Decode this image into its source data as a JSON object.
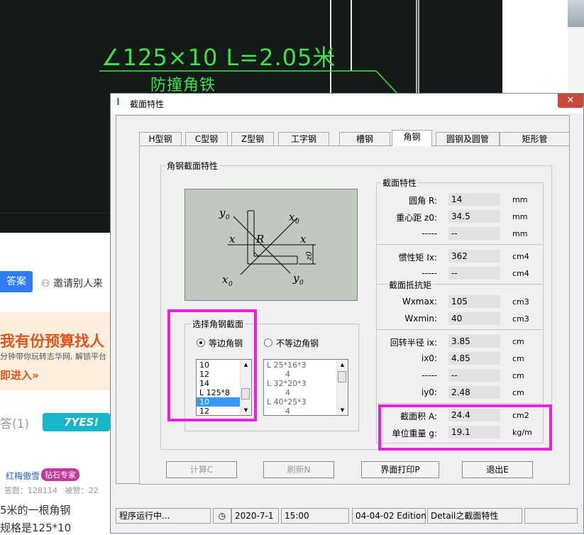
{
  "background": {
    "cad_annotation": "∠125×10   L=2.05米",
    "cad_note": "防撞角铁",
    "answer_button": "答案",
    "invite_link": "邀请别人来",
    "banner": {
      "main_prefix": "我有份预算",
      "main_highlight": "找人",
      "sub": "分钟带你玩转志华网, 解锁平台",
      "go": "即进入»"
    },
    "answers_count": "答(1)",
    "yes_logo": "7YES!",
    "user": {
      "name": "红梅傲雪",
      "tag": "钻石专家",
      "stats_answers_label": "答题：",
      "stats_answers": "128114",
      "stats_liked_label": "被赞：",
      "stats_liked": "22"
    },
    "post_line1": "5米的一根角钢",
    "post_line2": "规格是125*10"
  },
  "dialog": {
    "title": "截面特性",
    "close": "✕",
    "tabs": [
      {
        "label": "H型钢"
      },
      {
        "label": "C型钢"
      },
      {
        "label": "Z型钢"
      },
      {
        "label": "工字钢"
      },
      {
        "label": "槽钢"
      },
      {
        "label": "角钢",
        "active": true
      },
      {
        "label": "圆钢及圆管"
      },
      {
        "label": "矩形管"
      }
    ],
    "angle_group_label": "角钢截面特性",
    "diagram_labels": {
      "y0_top": "y",
      "x0_top": "x",
      "x_left": "x",
      "R": "R",
      "x_right": "x",
      "z0": "z0",
      "x0_bottom": "x",
      "y0_bottom": "y",
      "sub0": "0"
    },
    "select_group_label": "选择角钢截面",
    "radio_equal": "等边角钢",
    "radio_unequal": "不等边角钢",
    "equal_list": [
      "10",
      "12",
      "14",
      "L 125*8",
      "10",
      "12"
    ],
    "equal_selected_index": 4,
    "unequal_list": [
      "L 25*16*3",
      "4",
      "L 32*20*3",
      "4",
      "L 40*25*3",
      "4"
    ],
    "props_group_label": "截面特性",
    "rows": [
      {
        "label": "圆角  R:",
        "value": "14",
        "unit": "mm"
      },
      {
        "label": "重心距 z0:",
        "value": "34.5",
        "unit": "mm"
      },
      {
        "label": "-----",
        "value": "--",
        "unit": "mm"
      },
      {
        "label": "惯性矩 Ix:",
        "value": "362",
        "unit": "cm4"
      },
      {
        "label": "-----",
        "value": "--",
        "unit": "cm4"
      },
      {
        "label": "Wxmax:",
        "value": "105",
        "unit": "cm3"
      },
      {
        "label": "Wxmin:",
        "value": "40",
        "unit": "cm3"
      },
      {
        "label": "回转半径 ix:",
        "value": "3.85",
        "unit": "cm"
      },
      {
        "label": "ix0:",
        "value": "4.85",
        "unit": "cm"
      },
      {
        "label": "-----",
        "value": "--",
        "unit": "cm"
      },
      {
        "label": "iy0:",
        "value": "2.48",
        "unit": "cm"
      },
      {
        "label": "截面积 A:",
        "value": "24.4",
        "unit": "cm2"
      },
      {
        "label": "单位重量 g:",
        "value": "19.1",
        "unit": "kg/m"
      }
    ],
    "modulus_label": "截面抵抗矩",
    "buttons": {
      "calc": "计算C",
      "refresh": "刷新N",
      "print": "界面打印P",
      "exit": "退出E"
    },
    "status": {
      "running": "程序运行中...",
      "date": "2020-7-1",
      "time": "15:00",
      "edition": "04-04-02 Edition",
      "module": "Detail之截面特性"
    }
  },
  "colors": {
    "highlight": "#ee1fe0",
    "cad_green": "#3ee04c",
    "selection": "#3399ff"
  }
}
